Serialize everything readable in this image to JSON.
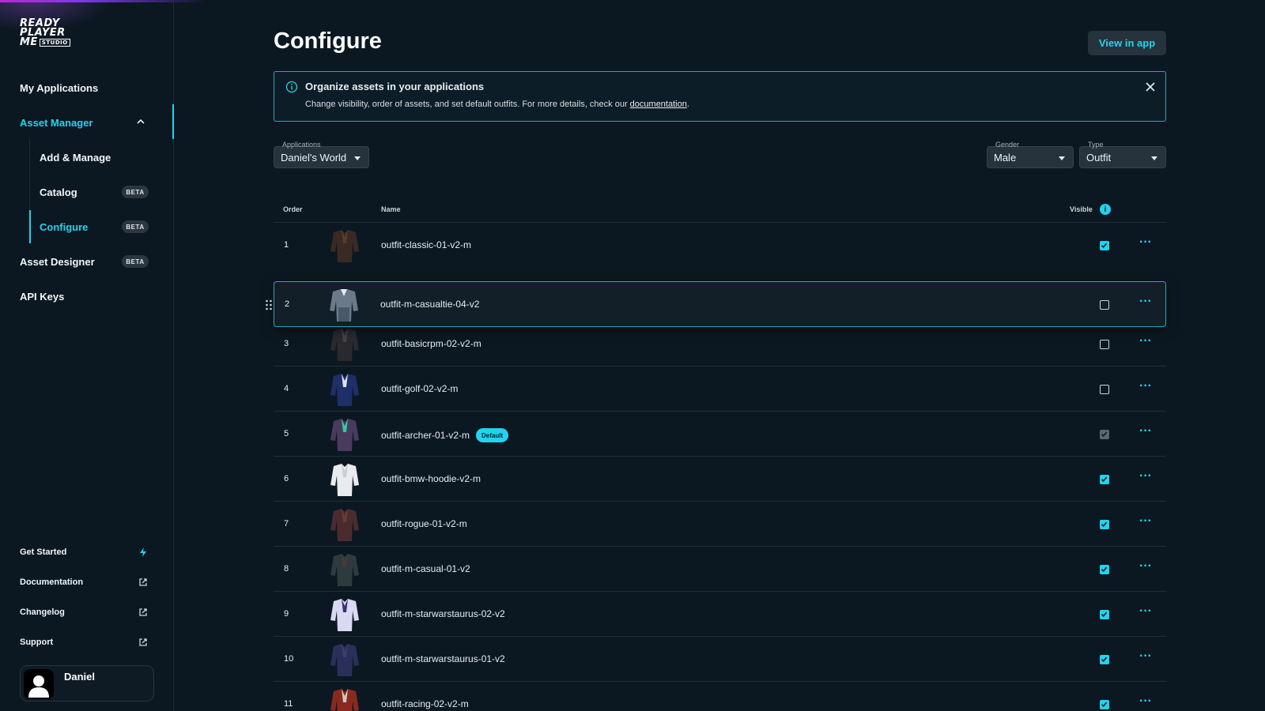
{
  "brand": {
    "logo_line1": "READY",
    "logo_line2": "PLAYER",
    "logo_line3": "ME",
    "logo_studio": "STUDIO"
  },
  "sidebar": {
    "nav": [
      {
        "label": "My Applications"
      },
      {
        "label": "Asset Manager",
        "active": true,
        "expanded": true
      },
      {
        "label": "Asset Designer",
        "badge": "BETA"
      },
      {
        "label": "API Keys"
      }
    ],
    "sub": [
      {
        "label": "Add & Manage"
      },
      {
        "label": "Catalog",
        "badge": "BETA"
      },
      {
        "label": "Configure",
        "badge": "BETA",
        "active": true
      }
    ],
    "footer": [
      {
        "label": "Get Started",
        "icon": "bolt-icon"
      },
      {
        "label": "Documentation",
        "icon": "external-link-icon"
      },
      {
        "label": "Changelog",
        "icon": "external-link-icon"
      },
      {
        "label": "Support",
        "icon": "external-link-icon"
      }
    ],
    "user": {
      "name": "Daniel"
    }
  },
  "header": {
    "title": "Configure",
    "view_button": "View in app"
  },
  "banner": {
    "title": "Organize assets in your applications",
    "text": "Change visibility, order of assets, and set default outfits. For more details, check our ",
    "link": "documentation",
    "text_end": "."
  },
  "filters": {
    "application": {
      "label": "Applications",
      "value": "Daniel's World"
    },
    "gender": {
      "label": "Gender",
      "value": "Male"
    },
    "type": {
      "label": "Type",
      "value": "Outfit"
    }
  },
  "table": {
    "headers": {
      "order": "Order",
      "name": "Name",
      "visible": "Visible"
    },
    "rows": [
      {
        "order": "1",
        "name": "outfit-classic-01-v2-m",
        "visible": "checked"
      },
      {
        "order": "3",
        "name": "outfit-basicrpm-02-v2-m",
        "visible": "unchecked"
      },
      {
        "order": "4",
        "name": "outfit-golf-02-v2-m",
        "visible": "unchecked"
      },
      {
        "order": "5",
        "name": "outfit-archer-01-v2-m",
        "visible": "disabled",
        "badge": "Default"
      },
      {
        "order": "6",
        "name": "outfit-bmw-hoodie-v2-m",
        "visible": "checked"
      },
      {
        "order": "7",
        "name": "outfit-rogue-01-v2-m",
        "visible": "checked"
      },
      {
        "order": "8",
        "name": "outfit-m-casual-01-v2",
        "visible": "checked"
      },
      {
        "order": "9",
        "name": "outfit-m-starwarstaurus-02-v2",
        "visible": "checked"
      },
      {
        "order": "10",
        "name": "outfit-m-starwarstaurus-01-v2",
        "visible": "checked"
      },
      {
        "order": "11",
        "name": "outfit-racing-02-v2-m",
        "visible": "checked"
      }
    ],
    "dragged_row": {
      "order": "2",
      "name": "outfit-m-casualtie-04-v2",
      "visible": "unchecked"
    },
    "more_glyph": "···"
  },
  "colors": {
    "accent": "#22d3ee",
    "background": "#0c1821",
    "surface": "#26333c"
  }
}
